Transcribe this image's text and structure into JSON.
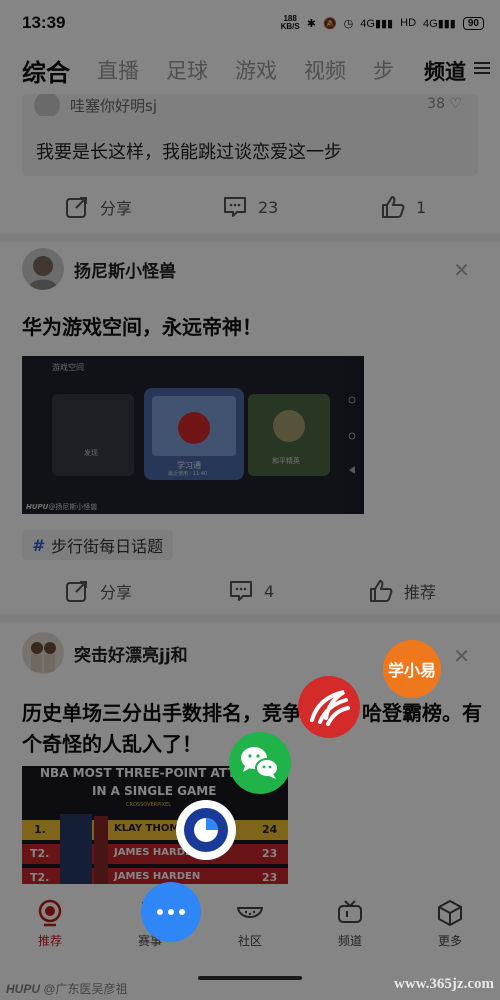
{
  "status_bar": {
    "time": "13:39",
    "speed_value": "188",
    "speed_unit": "KB/S",
    "network": "4G",
    "network2": "4G",
    "hd": "HD",
    "battery": "90"
  },
  "tabs": [
    "综合",
    "直播",
    "足球",
    "游戏",
    "视频",
    "步"
  ],
  "channel_label": "频道",
  "post0": {
    "quote_user": "哇塞你好明sj",
    "quote_likes": "38",
    "quote_text": "我要是长这样，我能跳过谈恋爱这一步",
    "share_label": "分享",
    "comments": "23",
    "likes": "1"
  },
  "post1": {
    "username": "扬尼斯小怪兽",
    "title": "华为游戏空间，永远帝神！",
    "image": {
      "header": "游戏空间",
      "card1": "发现",
      "card2": "学习通",
      "card2_sub": "最近使用 · 11:40",
      "card3": "和平精英",
      "watermark": "@扬尼斯小怪兽",
      "watermark_brand": "HUPU"
    },
    "topic": "步行街每日话题",
    "share_label": "分享",
    "comments": "4",
    "recommend_label": "推荐"
  },
  "post2": {
    "username": "突击好漂亮jj和",
    "title": "历史单场三分出手数排名，竞争第一，哈登霸榜。有个奇怪的人乱入了！",
    "image": {
      "heading_line1": "NBA MOST THREE-POINT ATTE",
      "heading_line2": "IN A SINGLE GAME",
      "source": "CROSSOVERPIXEL",
      "rows": [
        {
          "rank": "1.",
          "name": "KLAY THOMPSON",
          "value": "24"
        },
        {
          "rank": "T2.",
          "name": "JAMES HARDEN",
          "value": "23"
        },
        {
          "rank": "T2.",
          "name": "JAMES HARDEN",
          "value": "23"
        }
      ]
    }
  },
  "share_targets": {
    "xuexiaoyi": "学小易"
  },
  "bottom_nav": [
    {
      "label": "推荐",
      "icon": "whistle-icon"
    },
    {
      "label": "赛事",
      "icon": "trophy-icon"
    },
    {
      "label": "社区",
      "icon": "watermelon-icon"
    },
    {
      "label": "频道",
      "icon": "tv-icon"
    },
    {
      "label": "更多",
      "icon": "cube-icon"
    }
  ],
  "watermarks": {
    "left_brand": "HUPU",
    "left_handle": "@广东医吴彦祖",
    "right": "www.365jz.com"
  },
  "colors": {
    "accent_red": "#c01a1a",
    "fab_blue": "#2f86f6",
    "wechat_green": "#1fb34a",
    "xuexiaoyi_orange": "#f0781c"
  }
}
